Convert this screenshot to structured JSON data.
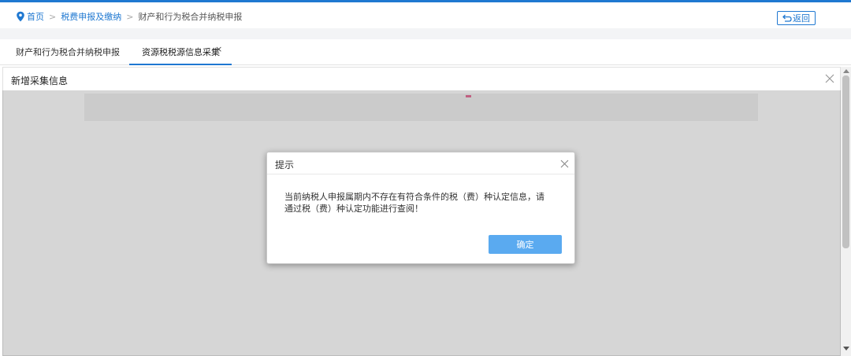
{
  "breadcrumb": {
    "items": [
      {
        "label": "首页"
      },
      {
        "label": "税费申报及缴纳"
      },
      {
        "label": "财产和行为税合并纳税申报"
      }
    ],
    "separator": ">"
  },
  "header": {
    "back_label": "返回"
  },
  "tabs": [
    {
      "label": "财产和行为税合并纳税申报"
    },
    {
      "label": "资源税税源信息采集",
      "close": "×"
    }
  ],
  "panel": {
    "title": "新增采集信息"
  },
  "dialog": {
    "title": "提示",
    "message_line1": "当前纳税人申报属期内不存在有符合条件的税（费）种认定信息，请",
    "message_line2": "通过税（费）种认定功能进行查阅！",
    "confirm_label": "确定"
  },
  "icons": {
    "location": "location-pin-icon",
    "back": "return-arrow-icon",
    "close": "close-icon"
  },
  "colors": {
    "primary": "#1f78d1",
    "confirm_button": "#5aaaf0",
    "top_border": "#1f78d1"
  }
}
